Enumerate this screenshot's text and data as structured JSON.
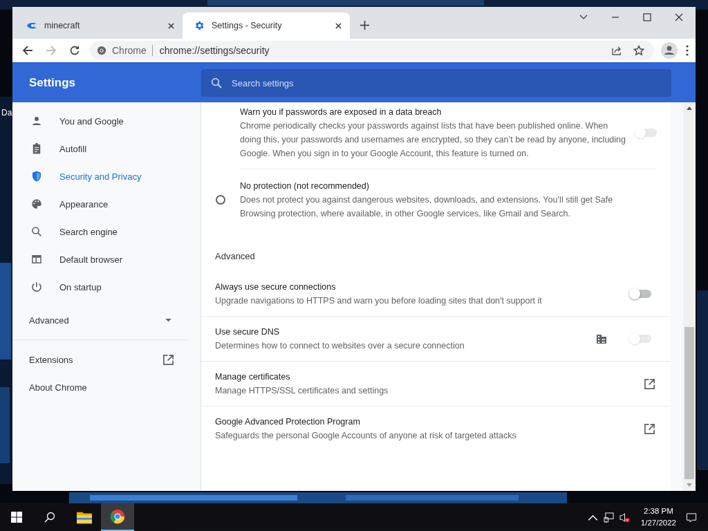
{
  "desktop": {
    "icon_label": "Da"
  },
  "browser": {
    "tabs": [
      {
        "title": "minecraft",
        "selected": false
      },
      {
        "title": "Settings - Security",
        "selected": true
      }
    ],
    "address_bar": {
      "site_label": "Chrome",
      "url": "chrome://settings/security"
    }
  },
  "settings": {
    "title": "Settings",
    "search": {
      "placeholder": "Search settings"
    },
    "sidebar": {
      "items": [
        {
          "label": "You and Google",
          "selected": false
        },
        {
          "label": "Autofill",
          "selected": false
        },
        {
          "label": "Security and Privacy",
          "selected": true
        },
        {
          "label": "Appearance",
          "selected": false
        },
        {
          "label": "Search engine",
          "selected": false
        },
        {
          "label": "Default browser",
          "selected": false
        },
        {
          "label": "On startup",
          "selected": false
        }
      ],
      "advanced": {
        "label": "Advanced",
        "expanded": false
      },
      "links": [
        {
          "label": "Extensions",
          "external": true
        },
        {
          "label": "About Chrome",
          "external": false
        }
      ]
    },
    "content": {
      "options": [
        {
          "kind": "toggle",
          "title": "Warn you if passwords are exposed in a data breach",
          "description": "Chrome periodically checks your passwords against lists that have been published online. When doing this, your passwords and usernames are encrypted, so they can’t be read by anyone, including Google. When you sign in to your Google Account, this feature is turned on.",
          "on": false,
          "disabled": true
        },
        {
          "kind": "radio",
          "title": "No protection (not recommended)",
          "description": "Does not protect you against dangerous websites, downloads, and extensions. You’ll still get Safe Browsing protection, where available, in other Google services, like Gmail and Search.",
          "selected": false
        }
      ],
      "section_title": "Advanced",
      "rows": [
        {
          "kind": "toggle",
          "title": "Always use secure connections",
          "description": "Upgrade navigations to HTTPS and warn you before loading sites that don't support it",
          "on": false,
          "disabled": false,
          "managed": false
        },
        {
          "kind": "toggle",
          "title": "Use secure DNS",
          "description": "Determines how to connect to websites over a secure connection",
          "on": false,
          "disabled": true,
          "managed": true
        },
        {
          "kind": "link",
          "title": "Manage certificates",
          "description": "Manage HTTPS/SSL certificates and settings"
        },
        {
          "kind": "link",
          "title": "Google Advanced Protection Program",
          "description": "Safeguards the personal Google Accounts of anyone at risk of targeted attacks"
        }
      ]
    }
  },
  "taskbar": {
    "apps": [
      {
        "kind": "explorer",
        "selected": false
      },
      {
        "kind": "chrome",
        "selected": true
      }
    ],
    "time": "2:38 PM",
    "date": "1/27/2022",
    "volume_muted": true
  }
}
